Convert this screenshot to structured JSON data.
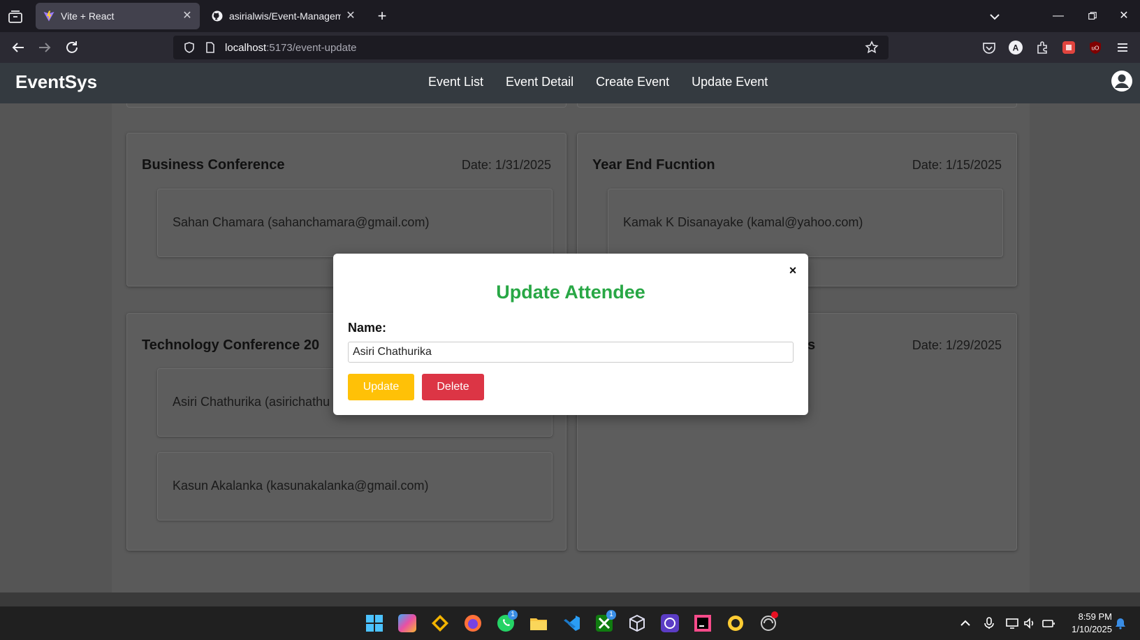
{
  "browser": {
    "tabs": [
      {
        "title": "Vite + React",
        "active": true
      },
      {
        "title": "asirialwis/Event-Management-S",
        "active": false
      }
    ],
    "url_host": "localhost",
    "url_path": ":5173/event-update"
  },
  "app": {
    "brand": "EventSys",
    "nav": [
      "Event List",
      "Event Detail",
      "Create Event",
      "Update Event"
    ]
  },
  "events": [
    {
      "title": "Business Conference",
      "date": "Date: 1/31/2025",
      "attendees": [
        "Sahan Chamara (sahanchamara@gmail.com)"
      ]
    },
    {
      "title": "Year End Fucntion",
      "date": "Date: 1/15/2025",
      "attendees": [
        "Kamak K Disanayake (kamal@yahoo.com)"
      ]
    },
    {
      "title": "Technology Conference 20",
      "date": "",
      "attendees": [
        "Asiri Chathurika (asirichathu",
        "Kasun Akalanka (kasunakalanka@gmail.com)"
      ]
    },
    {
      "title": "s",
      "date": "Date: 1/29/2025",
      "attendees": []
    }
  ],
  "modal": {
    "title": "Update Attendee",
    "close": "×",
    "label": "Name:",
    "name_value": "Asiri Chathurika",
    "update_label": "Update",
    "delete_label": "Delete"
  },
  "taskbar": {
    "time": "8:59 PM",
    "date": "1/10/2025",
    "badges": [
      "1",
      "1"
    ]
  },
  "colors": {
    "accent_green": "#28a745",
    "update_yellow": "#ffc107",
    "delete_red": "#dc3545",
    "header_dark": "#343a40"
  }
}
